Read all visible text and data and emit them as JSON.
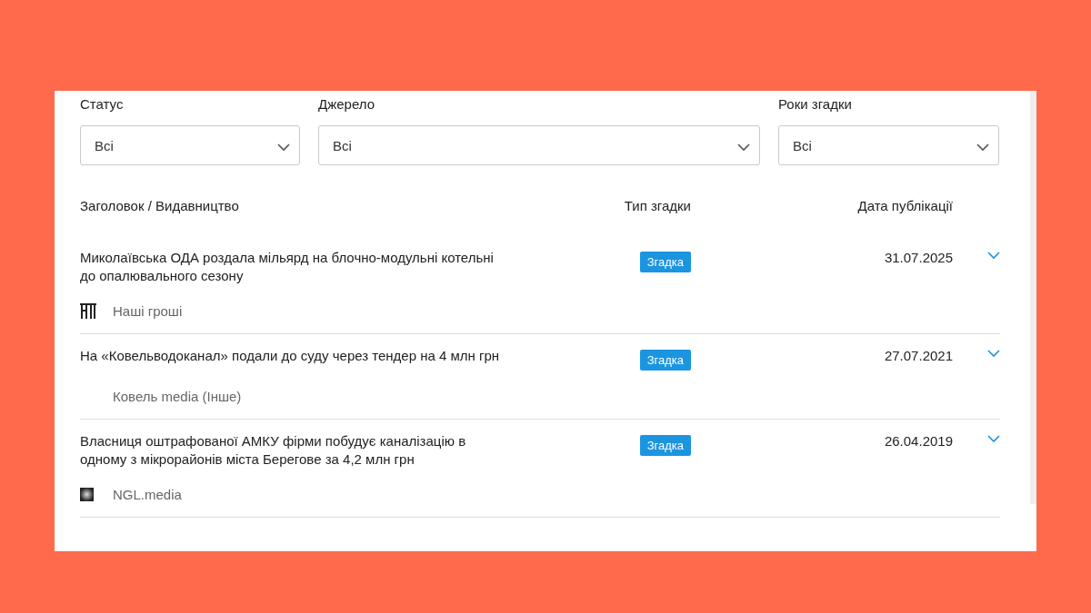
{
  "filters": [
    {
      "label": "Статус",
      "value": "Всі"
    },
    {
      "label": "Джерело",
      "value": "Всі"
    },
    {
      "label": "Роки згадки",
      "value": "Всі"
    }
  ],
  "columns": [
    "Заголовок / Видавництво",
    "Тип згадки",
    "Дата публікації"
  ],
  "rows": [
    {
      "title": "Миколаївська ОДА роздала мільярд на блочно-модульні котельні до опалювального сезону",
      "source": "Наші гроші",
      "kind": "monogram",
      "type": "Згадка",
      "date": "31.07.2025",
      "expanded": false
    },
    {
      "title": "На «Ковельводоканал» подали до суду через тендер на 4 млн грн",
      "source": "Ковель media (Інше)",
      "type": "Згадка",
      "date": "27.07.2021",
      "expanded": false
    },
    {
      "title": "Власниця оштрафованої АМКУ фірми побудує каналізацію в одному з мікрорайонів міста Берегове за 4,2 млн грн",
      "source": "NGL.media",
      "kind": "square",
      "type": "Згадка",
      "date": "26.04.2019",
      "expanded": false
    }
  ]
}
